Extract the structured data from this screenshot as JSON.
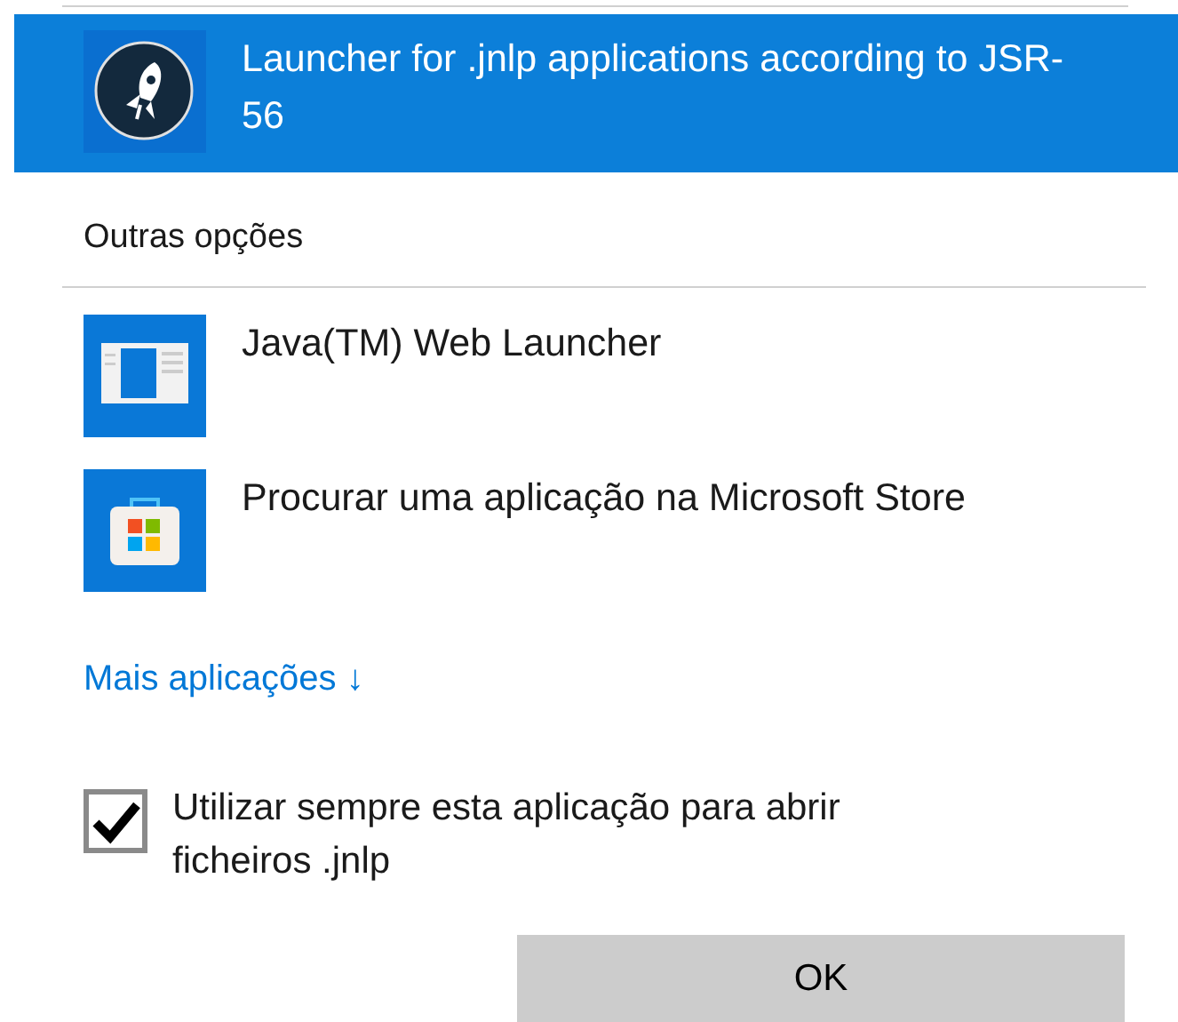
{
  "recommended": [
    {
      "kind": "rocket",
      "label": "Launcher for .jnlp applications according to JSR-56",
      "selected": true
    }
  ],
  "other_options": {
    "heading": "Outras opções",
    "items": [
      {
        "kind": "window",
        "label": "Java(TM) Web Launcher",
        "selected": false
      },
      {
        "kind": "store",
        "label": "Procurar uma aplicação na Microsoft Store",
        "selected": false
      }
    ]
  },
  "more_apps": {
    "label": "Mais aplicações",
    "arrow": "↓"
  },
  "always_use": {
    "label": "Utilizar sempre esta aplicação para abrir ficheiros .jnlp",
    "checked": true
  },
  "buttons": [
    "OK"
  ]
}
